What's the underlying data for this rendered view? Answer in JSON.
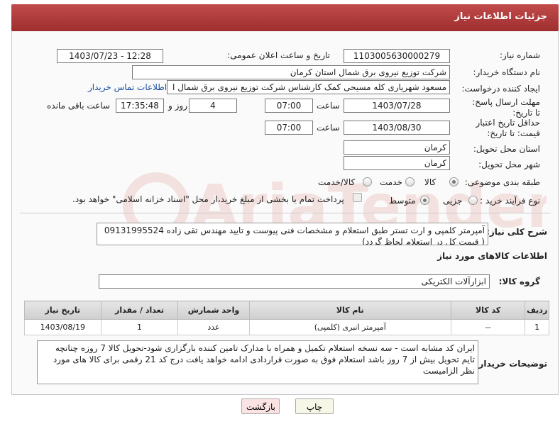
{
  "header": {
    "title": "جزئیات اطلاعات نیاز"
  },
  "form": {
    "need_number_label": "شماره نیاز:",
    "need_number": "1103005630000279",
    "announce_label": "تاریخ و ساعت اعلان عمومی:",
    "announce_value": "1403/07/23 - 12:28",
    "buyer_label": "نام دستگاه خریدار:",
    "buyer_value": "شرکت توزیع نیروی برق شمال استان کرمان",
    "requester_label": "ایجاد کننده درخواست:",
    "requester_value": "مسعود شهریاری کله مسیحی کمک کارشناس شرکت توزیع نیروی برق شمال ا",
    "contact_link": "اطلاعات تماس خریدار",
    "deadline_label": "مهلت ارسال پاسخ: تا تاریخ:",
    "deadline_date": "1403/07/28",
    "time_label": "ساعت",
    "deadline_time": "07:00",
    "days_value": "4",
    "days_label": "روز و",
    "remaining_time": "17:35:48",
    "remaining_label": "ساعت باقی مانده",
    "validity_label": "حداقل تاریخ اعتبار قیمت: تا تاریخ:",
    "validity_date": "1403/08/30",
    "validity_time": "07:00",
    "province_label": "استان محل تحویل:",
    "province_value": "کرمان",
    "city_label": "شهر محل تحویل:",
    "city_value": "کرمان",
    "category_label": "طبقه بندی موضوعی:",
    "category_options": [
      "کالا",
      "خدمت",
      "کالا/خدمت"
    ],
    "category_selected": "کالا",
    "process_label": "نوع فرآیند خرید :",
    "process_options": [
      "جزیی",
      "متوسط"
    ],
    "payment_note": "پرداخت تمام یا بخشی از مبلغ خرید،از محل \"اسناد خزانه اسلامی\" خواهد بود."
  },
  "general_desc": {
    "label": "شرح کلی نیاز:",
    "text": "آمپرمتر کلمپی و ارت تستر طبق استعلام و مشخصات فنی پیوست و تایید مهندس تقی زاده 09131995524  ( قیمت کل در استعلام لحاظ گردد)"
  },
  "goods_section": {
    "title": "اطلاعات کالاهای مورد نیاز",
    "group_label": "گروه کالا:",
    "group_value": "ابزارآلات الکتریکی"
  },
  "items_table": {
    "headers": [
      "ردیف",
      "کد کالا",
      "نام کالا",
      "واحد شمارش",
      "تعداد / مقدار",
      "تاریخ نیاز"
    ],
    "rows": [
      [
        "1",
        "--",
        "آمپرمتر انبری (کلمپی)",
        "عدد",
        "1",
        "1403/08/19"
      ]
    ]
  },
  "buyer_notes": {
    "label": "توضیحات خریدار:",
    "text": "ایران کد مشابه است - سه نسخه استعلام تکمیل و همراه با مدارک تامین کننده بارگزاری شود-تحویل کالا 7 روزه چنانچه تایم تحویل بیش از 7 روز باشد استعلام فوق به صورت قراردادی ادامه خواهد یافت  درج کد 21 رقمی برای کالا های مورد نظر الزامیست"
  },
  "buttons": {
    "print": "چاپ",
    "back": "بازگشت"
  },
  "watermark": {
    "text": "AriaTender.neT"
  },
  "colors": {
    "header": "#b03a3a",
    "link": "#1a4fa0",
    "back_button_bg": "#fbe3e3",
    "print_button_bg": "#f7f7e8"
  }
}
